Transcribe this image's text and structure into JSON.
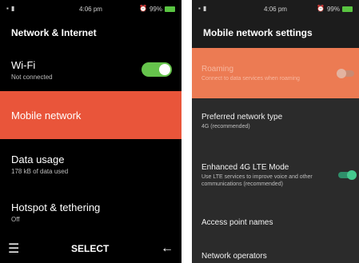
{
  "left_screen": {
    "status_bar": {
      "time": "4:06 pm",
      "battery": "99%"
    },
    "title": "Network & Internet",
    "items": [
      {
        "label": "Wi-Fi",
        "summary": "Not connected",
        "toggle": "on"
      },
      {
        "label": "Mobile network",
        "summary": ""
      },
      {
        "label": "Data usage",
        "summary": "178 kB of data used"
      },
      {
        "label": "Hotspot & tethering",
        "summary": "Off"
      }
    ],
    "softkeys": {
      "left": "menu-icon",
      "center": "SELECT",
      "right": "back-arrow-icon"
    }
  },
  "right_screen": {
    "status_bar": {
      "time": "4:06 pm",
      "battery": "99%"
    },
    "title": "Mobile network settings",
    "items": [
      {
        "label": "Roaming",
        "summary": "Connect to data services when roaming",
        "toggle": "off"
      },
      {
        "label": "Preferred network type",
        "summary": "4G (recommended)"
      },
      {
        "label": "Enhanced 4G LTE Mode",
        "summary": "Use LTE services to improve voice and other communications (recommended)",
        "toggle": "on"
      },
      {
        "label": "Access point names",
        "summary": ""
      },
      {
        "label": "Network operators",
        "summary": ""
      }
    ]
  },
  "colors": {
    "selected_highlight": "#e9553a",
    "roaming_highlight": "#ec7b53",
    "toggle_on": "#66c44c",
    "battery": "#59c441"
  }
}
